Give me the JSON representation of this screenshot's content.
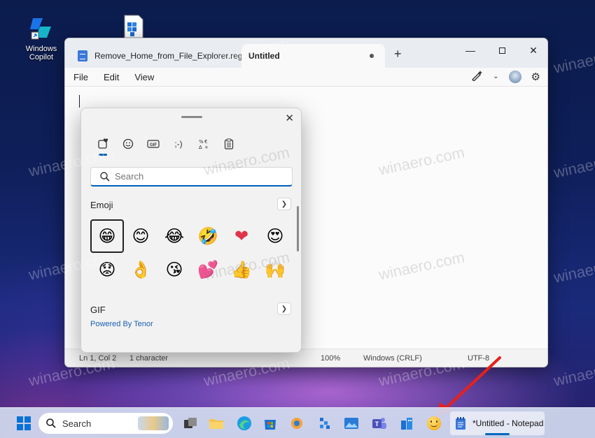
{
  "desktop": {
    "icons": [
      {
        "label": "Windows Copilot"
      },
      {
        "label": ""
      }
    ]
  },
  "notepad": {
    "tabs": [
      {
        "label": "Remove_Home_from_File_Explorer.reg"
      },
      {
        "label": "Untitled"
      }
    ],
    "new_tab": "+",
    "menu": [
      "File",
      "Edit",
      "View"
    ],
    "status": {
      "position": "Ln 1, Col 2",
      "characters": "1 character",
      "zoom": "100%",
      "line_ending": "Windows (CRLF)",
      "encoding": "UTF-8"
    }
  },
  "emoji_panel": {
    "search_placeholder": "Search",
    "categories": [
      "favorites-icon",
      "emoji-icon",
      "gif-icon",
      "kaomoji-icon",
      "symbols-icon",
      "clipboard-icon"
    ],
    "emoji_section": "Emoji",
    "emoji": [
      "😁",
      "😊",
      "😂",
      "🤣",
      "❤",
      "😍",
      "😟",
      "👌",
      "😘",
      "💕",
      "👍",
      "🙌"
    ],
    "gif_section": "GIF",
    "powered_by": "Powered By Tenor"
  },
  "taskbar": {
    "search_label": "Search",
    "active_window": "*Untitled - Notepad"
  },
  "watermark": "winaero.com",
  "colors": {
    "accent": "#005fb8",
    "arrow": "#e8201a"
  }
}
